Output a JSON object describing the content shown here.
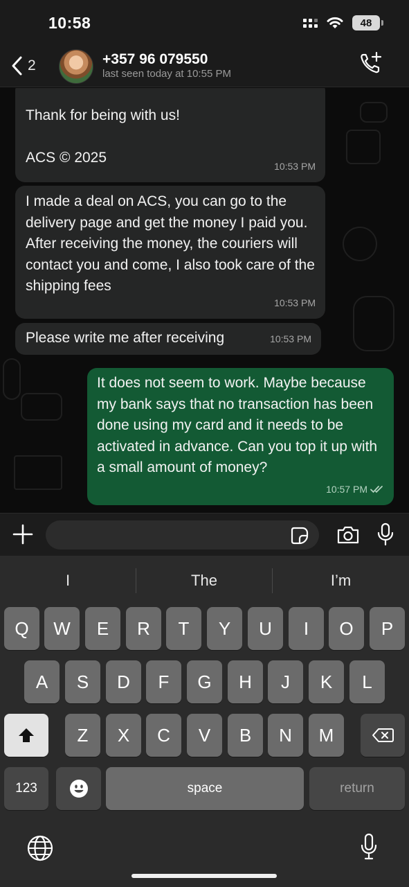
{
  "status": {
    "time": "10:58",
    "battery": "48"
  },
  "header": {
    "back_count": "2",
    "contact_name": "+357 96 079550",
    "contact_status": "last seen today at 10:55 PM"
  },
  "messages": [
    {
      "direction": "incoming",
      "text": "Thank for being with us!",
      "footer": "ACS © 2025",
      "time": "10:53 PM"
    },
    {
      "direction": "incoming",
      "text": "I made a deal on ACS, you can go to the delivery page and get the money I paid you. After receiving the money, the couriers will contact you and come, I also took care of the shipping fees",
      "time": "10:53 PM"
    },
    {
      "direction": "incoming",
      "text": "Please write me after receiving",
      "time": "10:53 PM"
    },
    {
      "direction": "outgoing",
      "text": "It does not seem to work. Maybe because my bank says that no transaction has been done using my card and it needs to be activated in advance. Can you top it up with a small amount of money?",
      "time": "10:57 PM"
    }
  ],
  "input": {
    "placeholder": ""
  },
  "keyboard": {
    "suggestions": [
      "I",
      "The",
      "I’m"
    ],
    "row1": [
      "Q",
      "W",
      "E",
      "R",
      "T",
      "Y",
      "U",
      "I",
      "O",
      "P"
    ],
    "row2": [
      "A",
      "S",
      "D",
      "F",
      "G",
      "H",
      "J",
      "K",
      "L"
    ],
    "row3": [
      "Z",
      "X",
      "C",
      "V",
      "B",
      "N",
      "M"
    ],
    "numbers_label": "123",
    "space_label": "space",
    "return_label": "return"
  },
  "colors": {
    "outgoing_bubble": "#135a34",
    "incoming_bubble": "#252626",
    "header_bg": "#1b1b1b",
    "keyboard_bg": "#2b2b2b"
  }
}
